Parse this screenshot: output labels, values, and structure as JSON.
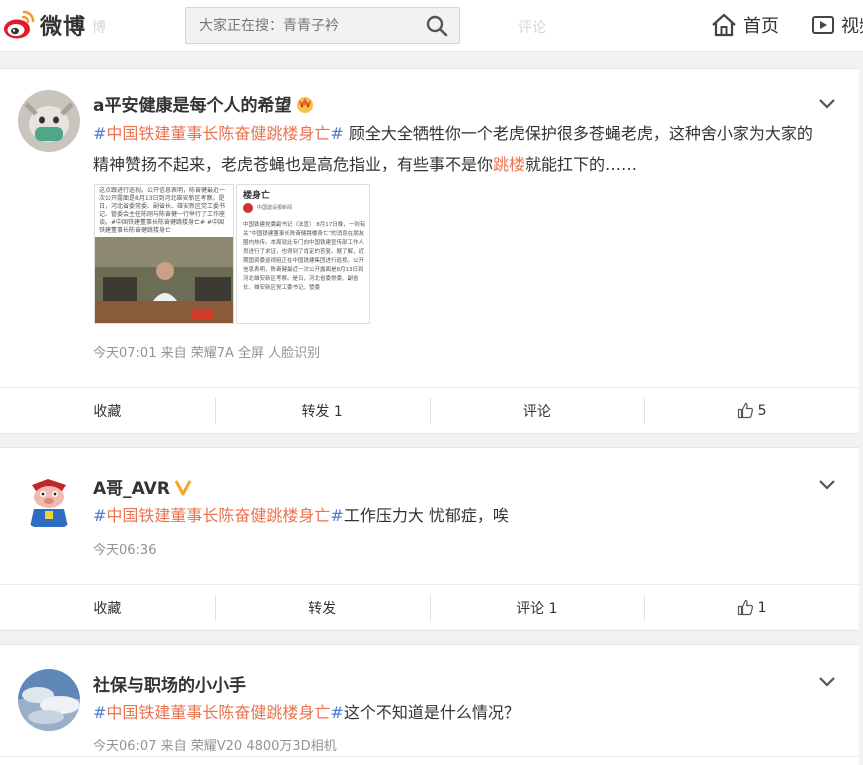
{
  "header": {
    "logo_text": "微博",
    "ghost_left": "博",
    "ghost_center": "评论",
    "search": {
      "placeholder": "大家正在搜：青青子衿"
    },
    "nav": [
      {
        "label": "首页",
        "icon": "home-icon"
      },
      {
        "label": "视频",
        "icon": "video-icon"
      }
    ]
  },
  "colors": {
    "topic": "#eb7350",
    "brand": "#e6162d",
    "meta": "#939393"
  },
  "posts": [
    {
      "username": "a平安健康是每个人的希望",
      "badge": "crown-emoji",
      "topic": "中国铁建董事长陈奋健跳楼身亡",
      "text_a": " 顾全大全牺牲你一个老虎保护很多苍蝇老虎，这种舍小家为大家的精神赞扬不起来，老虎苍蝇也是高危指业，有些事不是你",
      "keyword": "跳楼",
      "text_b": "就能扛下的……",
      "meta": "今天07:01  来自 荣耀7A 全屏 人脸识别",
      "images": {
        "left_caption": "这点跟进行巡视。公开信息表明，陈奋健最近一次公开露面是8月13日到河北雄安新区考察。是日，河北省委常委、副省长、雄安新区党工委书记、管委会主任陈刚与陈奋健一行举行了工作座谈。#中国铁建董事长陈奋健跳楼身亡# #中国铁建董事长陈奋健跳楼身亡",
        "right_title": "楼身亡",
        "right_source": "中国建设报新闻",
        "right_body": "中国铁建党委副书记（法宣） 8月17日晚，一则有关“中国铁建董事长陈奋健跳楼身亡”的消息在朋友圈内热传。本周就此专门向中国铁建宣传部工作人员进行了求证，也得到了肯定的答复。据了解，近期国资委巡视组正在中国铁建集团进行巡视。公开信息表明，陈奋健最近一次公开露面是8月13日到河北雄安新区考察。是日，河北省委常委、副省长、雄安新区党工委书记、管委"
      },
      "actions": {
        "favorite": "收藏",
        "repost": "转发 1",
        "comment": "评论",
        "like": "5"
      }
    },
    {
      "username": "A哥_AVR",
      "badge": "verified-v-icon",
      "topic": "中国铁建董事长陈奋健跳楼身亡",
      "text_a": "工作压力大 忧郁症，唉",
      "meta": "今天06:36",
      "actions": {
        "favorite": "收藏",
        "repost": "转发",
        "comment": "评论 1",
        "like": "1"
      }
    },
    {
      "username": "社保与职场的小小手",
      "topic": "中国铁建董事长陈奋健跳楼身亡",
      "text_a": "这个不知道是什么情况？",
      "meta": "今天06:07  来自 荣耀V20 4800万3D相机"
    }
  ]
}
